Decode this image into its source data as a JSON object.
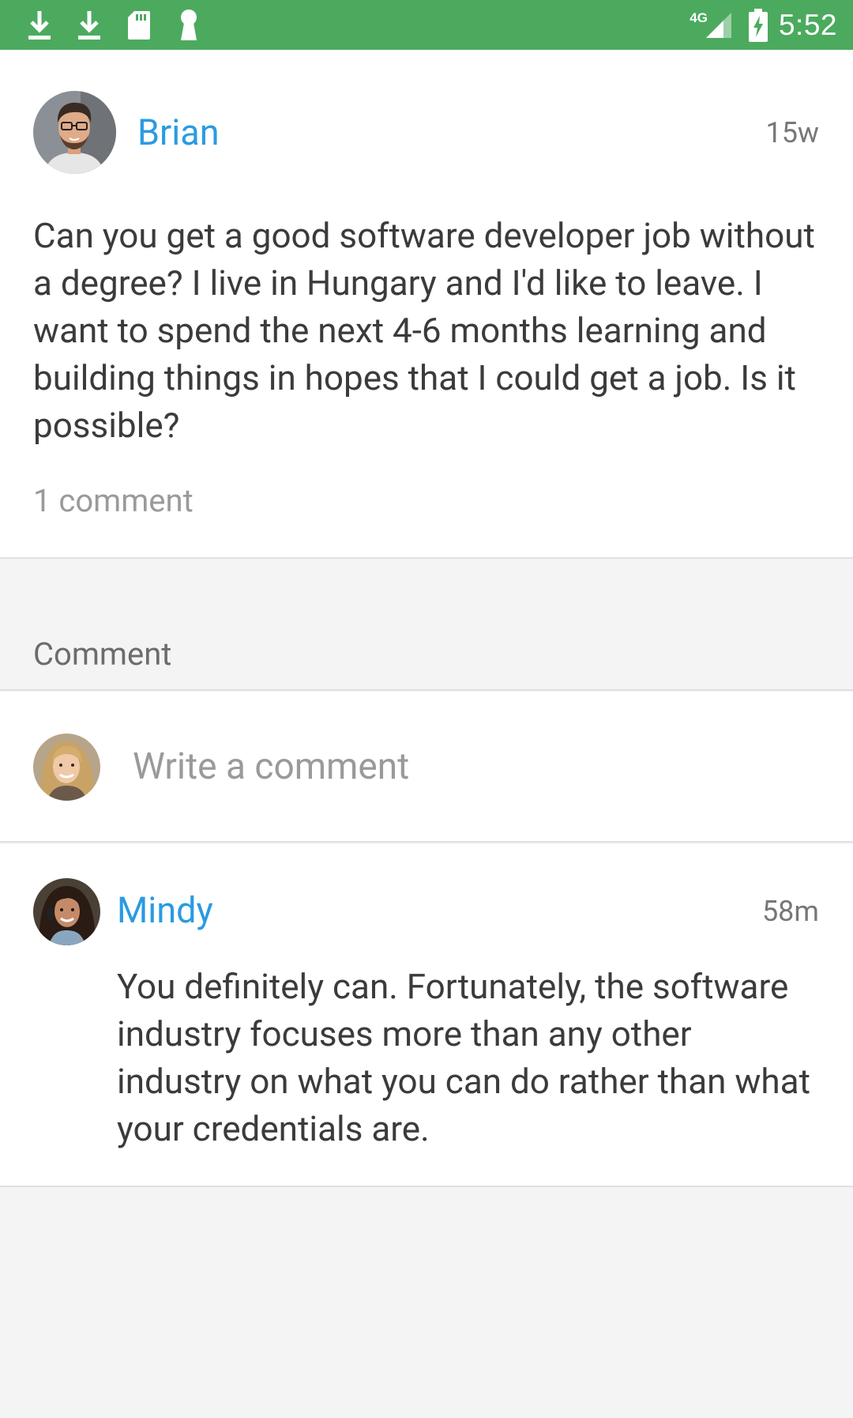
{
  "status_bar": {
    "network": "4G",
    "time": "5:52",
    "icons": [
      "download-icon",
      "download-icon",
      "sd-card-icon",
      "keyhole-icon",
      "signal-icon",
      "battery-charging-icon"
    ]
  },
  "post": {
    "author": "Brian",
    "time": "15w",
    "text": "Can you get a good software developer job without a degree? I live in Hungary and I'd like to leave. I want to spend the next 4-6 months learning and building things in hopes that I could get a job. Is it possible?",
    "comment_count": "1 comment"
  },
  "comments_section": {
    "title": "Comment"
  },
  "compose": {
    "placeholder": "Write a comment"
  },
  "comments": [
    {
      "author": "Mindy",
      "time": "58m",
      "text": "You definitely can. Fortunately, the software industry focuses more than any other industry on what you can do rather than what your credentials are."
    }
  ],
  "colors": {
    "status_bar": "#4caa5f",
    "name_link": "#2a9be0",
    "body_text": "#3b3b3b",
    "muted_text": "#9a9a9a",
    "background": "#f4f4f4"
  }
}
